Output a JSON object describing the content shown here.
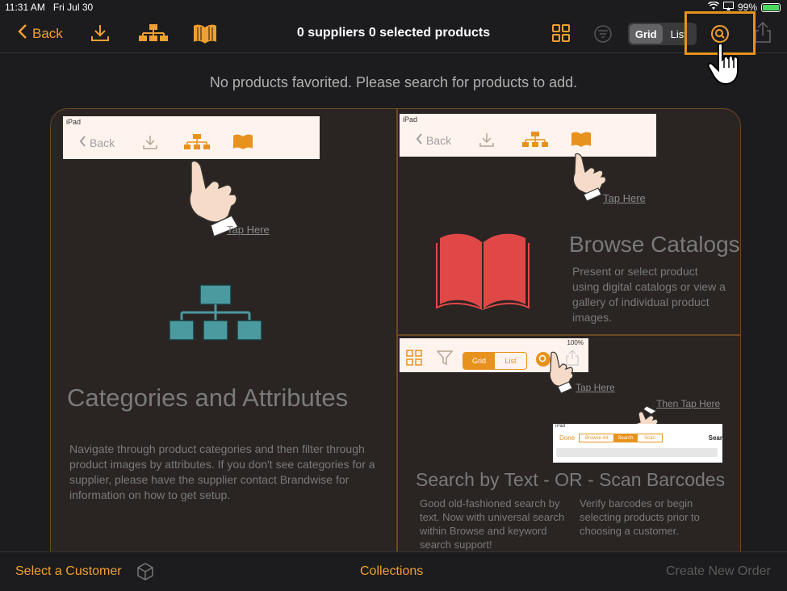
{
  "status_bar": {
    "time": "11:31 AM",
    "date": "Fri Jul 30",
    "battery": "99%"
  },
  "nav": {
    "back_label": "Back",
    "title": "0 suppliers 0 selected products",
    "segment": [
      "Grid",
      "List"
    ],
    "segment_selected": "Grid"
  },
  "empty_message": "No products favorited. Please search for products to add.",
  "tutorial": {
    "ipad_label": "iPad",
    "back_label": "Back",
    "tap_here": "Tap Here",
    "then_tap_here": "Then Tap Here",
    "categories": {
      "heading": "Categories and Attributes",
      "description": "Navigate through product categories and then filter through product images by attributes.  If you don't see categories for a supplier, please have the supplier contact Brandwise for information on how to get setup."
    },
    "browse": {
      "heading": "Browse Catalogs",
      "description": "Present or select  product using digital catalogs or view a gallery of individual product images."
    },
    "search": {
      "heading": "Search by Text - OR - Scan Barcodes",
      "description_left": "Good old-fashioned search by text.  Now with universal search within Browse and keyword search support!",
      "description_right": "Verify barcodes or begin selecting products  prior to choosing a  customer.",
      "mini_segment": [
        "Grid",
        "List"
      ],
      "mini_status": "100%",
      "mini_search_bar": {
        "done": "Done",
        "tabs": [
          "Browse All",
          "Search",
          "Scan"
        ],
        "right": "Sear"
      }
    }
  },
  "bottom_bar": {
    "select_customer": "Select a Customer",
    "collections": "Collections",
    "create_order": "Create New Order"
  },
  "colors": {
    "accent": "#f0a030",
    "highlight": "#e8921e",
    "panel": "#2a2423",
    "teal": "#4a9aa0",
    "red": "#e04848"
  }
}
